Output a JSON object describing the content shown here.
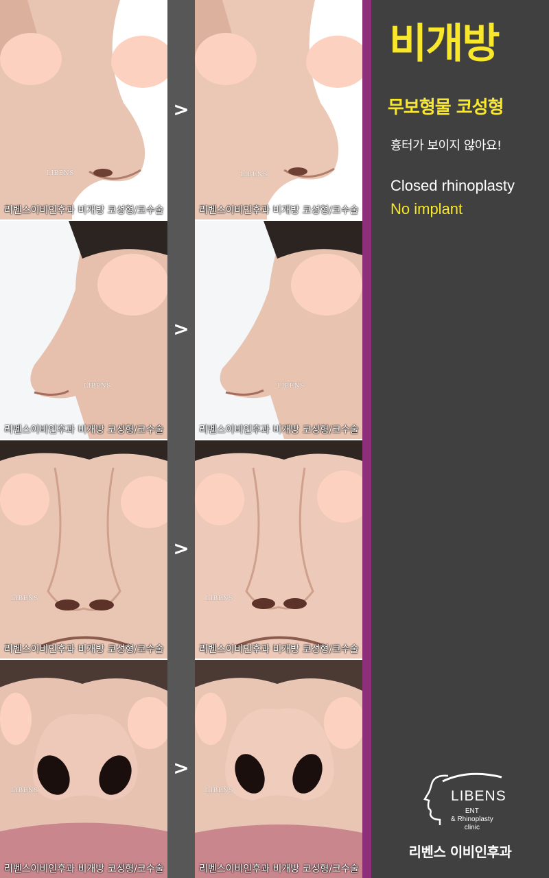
{
  "title": "비개방",
  "subtitle": "무보형물 코성형",
  "tagline": "흉터가 보이지 않아요!",
  "english": {
    "line1": "Closed rhinoplasty",
    "line2": "No implant"
  },
  "logo": {
    "word": "LIBENS",
    "sub": "ENT\n& Rhinoplasty\nclinic"
  },
  "clinic_name": "리벤스 이비인후과",
  "arrow": ">",
  "photo_caption": "리벤스이비인후과 비개방 코성형/코수술",
  "photo_watermark": "LIBENS",
  "rows": [
    {
      "view": "oblique",
      "before": "before",
      "after": "after"
    },
    {
      "view": "profile",
      "before": "before",
      "after": "after"
    },
    {
      "view": "frontal",
      "before": "before",
      "after": "after"
    },
    {
      "view": "basal",
      "before": "before",
      "after": "after"
    }
  ],
  "colors": {
    "accent_yellow": "#f8e72a",
    "panel_gray": "#404040",
    "accent_purple": "#8e2f79",
    "divider_gray": "#575757",
    "privacy_mask": "#fdd1bf"
  }
}
